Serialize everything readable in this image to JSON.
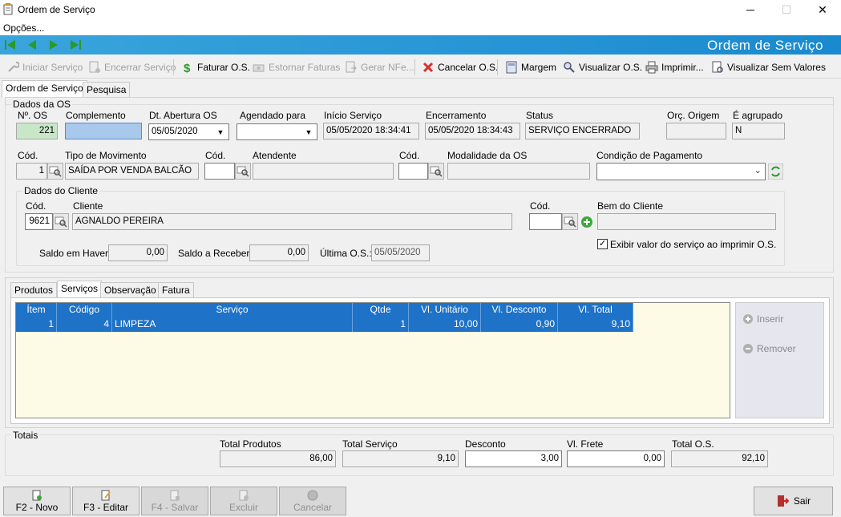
{
  "window": {
    "title": "Ordem de Serviço",
    "minimize": "─",
    "maximize": "☐",
    "close": "✕"
  },
  "menu": {
    "options": "Opções..."
  },
  "navbar": {
    "title": "Ordem de Serviço"
  },
  "toolbar": {
    "iniciar": "Iniciar Serviço",
    "encerrar": "Encerrar Serviço",
    "faturar": "Faturar O.S.",
    "estornar": "Estornar Faturas",
    "gerar_nfe": "Gerar NFe...",
    "cancelar": "Cancelar O.S.",
    "margem": "Margem",
    "visualizar": "Visualizar O.S.",
    "imprimir": "Imprimir...",
    "visualizar_sem": "Visualizar Sem Valores"
  },
  "tabs": {
    "ordem": "Ordem de Serviço",
    "pesquisa": "Pesquisa"
  },
  "dados_os": {
    "group": "Dados da OS",
    "num_label": "Nº. OS",
    "num": "221",
    "complemento_label": "Complemento",
    "complemento": "",
    "abertura_label": "Dt. Abertura OS",
    "abertura": "05/05/2020",
    "agendado_label": "Agendado para",
    "agendado": "  /  /",
    "inicio_label": "Início Serviço",
    "inicio": "05/05/2020 18:34:41",
    "encerramento_label": "Encerramento",
    "encerramento": "05/05/2020 18:34:43",
    "status_label": "Status",
    "status": "SERVIÇO ENCERRADO",
    "orc_label": "Orç. Origem",
    "orc": "",
    "agrupado_label": "É agrupado",
    "agrupado": "N",
    "cod_label": "Cód.",
    "tipo_cod": "1",
    "tipo_label": "Tipo de Movimento",
    "tipo": "SAÍDA POR VENDA BALCÃO",
    "atendente_cod": "",
    "atendente_label": "Atendente",
    "atendente": "",
    "modalidade_cod": "",
    "modalidade_label": "Modalidade da OS",
    "modalidade": "",
    "condicao_label": "Condição de Pagamento",
    "condicao": ""
  },
  "cliente": {
    "group": "Dados do Cliente",
    "cod_label": "Cód.",
    "cod": "9621",
    "cliente_label": "Cliente",
    "nome": "AGNALDO PEREIRA",
    "bem_cod_label": "Cód.",
    "bem_cod": "",
    "bem_label": "Bem do Cliente",
    "bem": "",
    "saldo_haver_label": "Saldo em Haver:",
    "saldo_haver": "0,00",
    "saldo_receber_label": "Saldo a Receber:",
    "saldo_receber": "0,00",
    "ultima_label": "Última O.S.:",
    "ultima": "05/05/2020",
    "exibir_label": "Exibir valor do serviço ao imprimir O.S.",
    "exibir_checked": true
  },
  "subtabs": {
    "produtos": "Produtos",
    "servicos": "Serviços",
    "observacao": "Observação",
    "fatura": "Fatura"
  },
  "grid": {
    "headers": [
      "Ítem",
      "Código",
      "Serviço",
      "Qtde",
      "Vl. Unitário",
      "Vl. Desconto",
      "Vl. Total"
    ],
    "rows": [
      [
        "1",
        "4",
        "LIMPEZA",
        "1",
        "10,00",
        "0,90",
        "9,10"
      ]
    ]
  },
  "side": {
    "inserir": "Inserir",
    "remover": "Remover"
  },
  "totais": {
    "group": "Totais",
    "produtos_label": "Total Produtos",
    "produtos": "86,00",
    "servico_label": "Total Serviço",
    "servico": "9,10",
    "desconto_label": "Desconto",
    "desconto": "3,00",
    "frete_label": "Vl. Frete",
    "frete": "0,00",
    "os_label": "Total O.S.",
    "os": "92,10"
  },
  "bottom": {
    "novo": "F2 - Novo",
    "editar": "F3 - Editar",
    "salvar": "F4 - Salvar",
    "excluir": "Excluir",
    "cancelar": "Cancelar",
    "sair": "Sair"
  }
}
